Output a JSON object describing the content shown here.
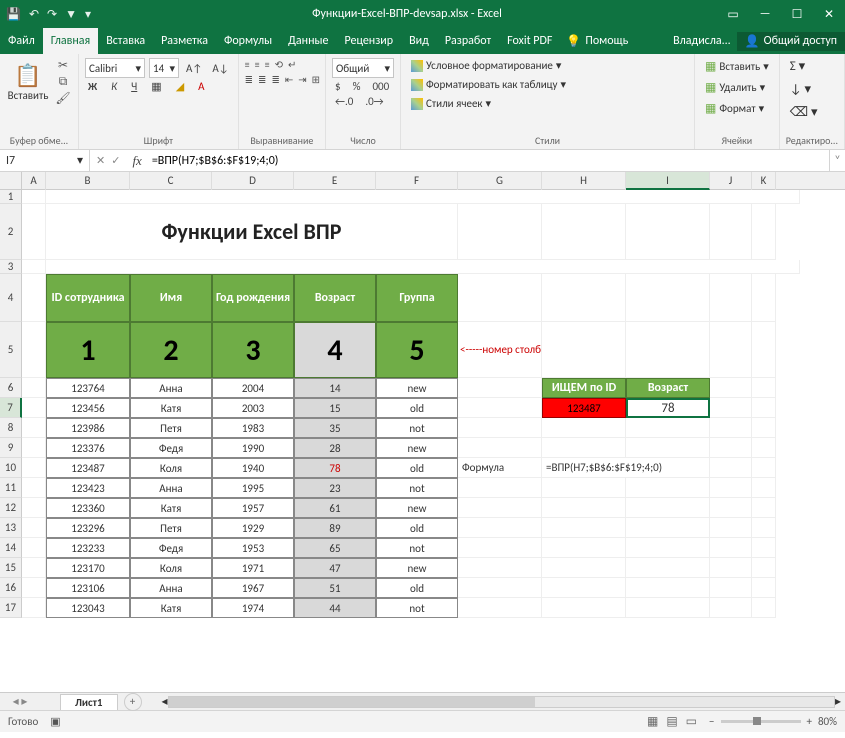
{
  "titlebar": {
    "title": "Функции-Excel-ВПР-devsap.xlsx - Excel"
  },
  "menu": {
    "file": "Файл",
    "home": "Главная",
    "insert": "Вставка",
    "layout": "Разметка",
    "formulas": "Формулы",
    "data": "Данные",
    "review": "Рецензир",
    "view": "Вид",
    "developer": "Разработ",
    "foxit": "Foxit PDF",
    "help": "Помощь",
    "user": "Владисла...",
    "share": "Общий доступ"
  },
  "ribbon": {
    "paste": "Вставить",
    "clipboard_label": "Буфер обме...",
    "font_name": "Calibri",
    "font_size": "14",
    "font_label": "Шрифт",
    "align_label": "Выравнивание",
    "number_format": "Общий",
    "number_label": "Число",
    "style_cond": "Условное форматирование",
    "style_table": "Форматировать как таблицу",
    "style_cell": "Стили ячеек",
    "style_label": "Стили",
    "cells_insert": "Вставить",
    "cells_delete": "Удалить",
    "cells_format": "Формат",
    "cells_label": "Ячейки",
    "edit_label": "Редактиро..."
  },
  "namebox": {
    "ref": "I7"
  },
  "formula_bar": {
    "value": "=ВПР(H7;$B$6:$F$19;4;0)"
  },
  "columns": [
    "A",
    "B",
    "C",
    "D",
    "E",
    "F",
    "G",
    "H",
    "I",
    "J",
    "K"
  ],
  "sheet": {
    "title": "Функции Excel ВПР",
    "headers": {
      "id": "ID сотрудника",
      "name": "Имя",
      "year": "Год рождения",
      "age": "Возраст",
      "group": "Группа"
    },
    "col_nums": [
      "1",
      "2",
      "3",
      "4",
      "5"
    ],
    "col_note": "<-----номер столбца",
    "lookup_head_id": "ИЩЕМ по ID",
    "lookup_head_age": "Возраст",
    "lookup_id": "123487",
    "lookup_result": "78",
    "formula_label": "Формула",
    "formula_text": "=ВПР(H7;$B$6:$F$19;4;0)",
    "rows": [
      {
        "id": "123764",
        "name": "Анна",
        "year": "2004",
        "age": "14",
        "group": "new"
      },
      {
        "id": "123456",
        "name": "Катя",
        "year": "2003",
        "age": "15",
        "group": "old"
      },
      {
        "id": "123986",
        "name": "Петя",
        "year": "1983",
        "age": "35",
        "group": "not"
      },
      {
        "id": "123376",
        "name": "Федя",
        "year": "1990",
        "age": "28",
        "group": "new"
      },
      {
        "id": "123487",
        "name": "Коля",
        "year": "1940",
        "age": "78",
        "group": "old"
      },
      {
        "id": "123423",
        "name": "Анна",
        "year": "1995",
        "age": "23",
        "group": "not"
      },
      {
        "id": "123360",
        "name": "Катя",
        "year": "1957",
        "age": "61",
        "group": "new"
      },
      {
        "id": "123296",
        "name": "Петя",
        "year": "1929",
        "age": "89",
        "group": "old"
      },
      {
        "id": "123233",
        "name": "Федя",
        "year": "1953",
        "age": "65",
        "group": "not"
      },
      {
        "id": "123170",
        "name": "Коля",
        "year": "1971",
        "age": "47",
        "group": "new"
      },
      {
        "id": "123106",
        "name": "Анна",
        "year": "1967",
        "age": "51",
        "group": "old"
      },
      {
        "id": "123043",
        "name": "Катя",
        "year": "1974",
        "age": "44",
        "group": "not"
      }
    ]
  },
  "tabs": {
    "sheet1": "Лист1"
  },
  "status": {
    "ready": "Готово",
    "zoom": "80%"
  }
}
